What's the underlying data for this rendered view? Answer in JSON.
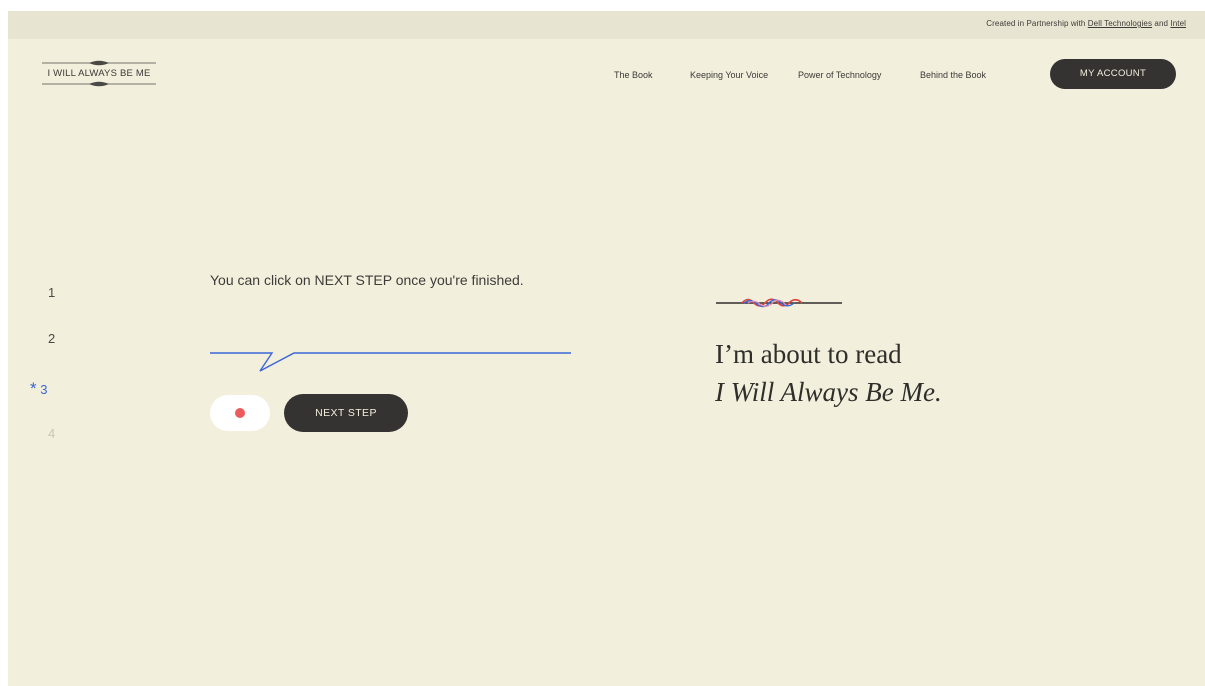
{
  "topbar": {
    "prefix": "Created in Partnership with",
    "link1": "Dell Technologies",
    "conjunction": "and",
    "link2": "Intel"
  },
  "logo": {
    "text": "I WILL ALWAYS BE ME"
  },
  "nav": {
    "items": [
      "The Book",
      "Keeping Your Voice",
      "Power of Technology",
      "Behind the Book"
    ],
    "account": "MY ACCOUNT"
  },
  "steps": {
    "items": [
      "1",
      "2",
      "3",
      "4"
    ],
    "active_marker": "*",
    "active_index": 3
  },
  "prompt": {
    "instruction": "You can click on NEXT STEP once you're finished.",
    "next_label": "NEXT STEP"
  },
  "reading": {
    "line1": "I’m about to read",
    "line2": "I Will Always Be Me."
  },
  "colors": {
    "background": "#f3efdd",
    "topbar": "#e8e4d2",
    "button_dark": "#343331",
    "accent_blue": "#3a66d6",
    "record_red": "#ec5a5c"
  }
}
